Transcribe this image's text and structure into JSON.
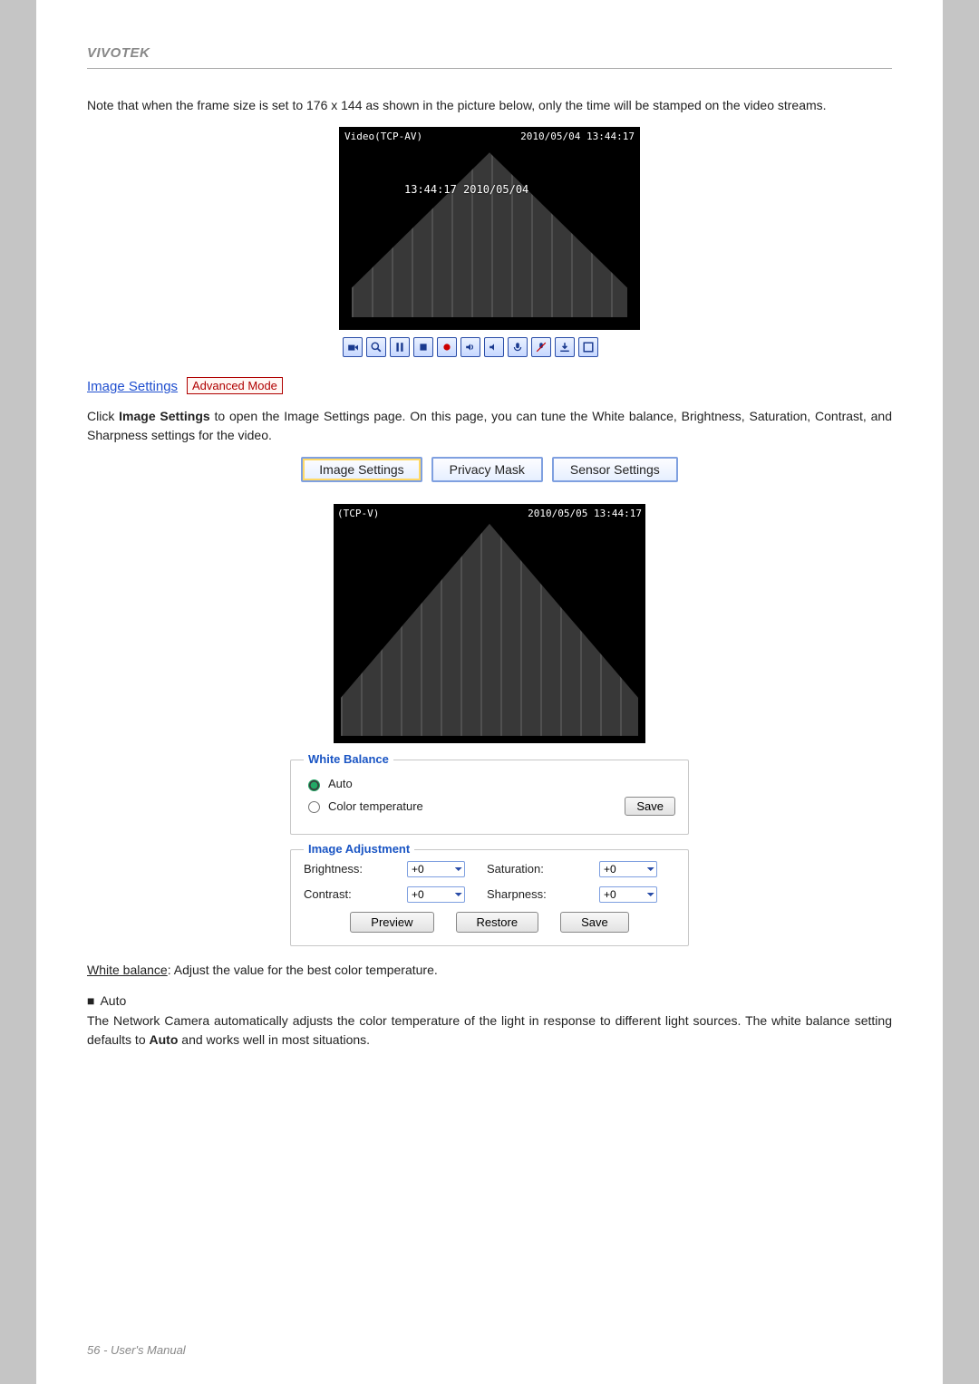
{
  "brand": "VIVOTEK",
  "note_text": "Note that when the frame size is set to 176 x 144 as shown in the picture below, only the time will be stamped on the video streams.",
  "small_preview": {
    "top_left": "Video(TCP-AV)",
    "top_right": "2010/05/04 13:44:17",
    "center": "13:44:17 2010/05/04"
  },
  "toolbar_icons": [
    "camera-icon",
    "zoom-icon",
    "pause-icon",
    "stop-icon",
    "record-icon",
    "volume-up-icon",
    "volume-down-icon",
    "mic-on-icon",
    "mic-off-icon",
    "download-icon",
    "fullscreen-icon"
  ],
  "section": {
    "link": "Image Settings",
    "badge": "Advanced Mode",
    "paragraph_prefix": "Click ",
    "paragraph_bold": "Image Settings",
    "paragraph_suffix": " to open the Image Settings page. On this page, you can tune the White balance, Brightness, Saturation, Contrast, and Sharpness settings for the video."
  },
  "tabs": {
    "image": "Image Settings",
    "privacy": "Privacy Mask",
    "sensor": "Sensor Settings"
  },
  "large_preview": {
    "top_left": "(TCP-V)",
    "top_right": "2010/05/05 13:44:17"
  },
  "white_balance": {
    "legend": "White Balance",
    "auto": "Auto",
    "color_temp": "Color temperature",
    "save": "Save"
  },
  "adjust": {
    "legend": "Image Adjustment",
    "brightness_label": "Brightness:",
    "saturation_label": "Saturation:",
    "contrast_label": "Contrast:",
    "sharpness_label": "Sharpness:",
    "value": "+0"
  },
  "buttons": {
    "preview": "Preview",
    "restore": "Restore",
    "save": "Save"
  },
  "wb_text_term": "White balance",
  "wb_text_rest": ": Adjust the value for the best color temperature.",
  "auto_heading": "Auto",
  "auto_para_prefix": "The Network Camera automatically adjusts the color temperature of the light in response to different light sources. The white balance setting defaults to ",
  "auto_para_bold": "Auto",
  "auto_para_suffix": " and works well in most situations.",
  "footer": "56 - User's Manual"
}
